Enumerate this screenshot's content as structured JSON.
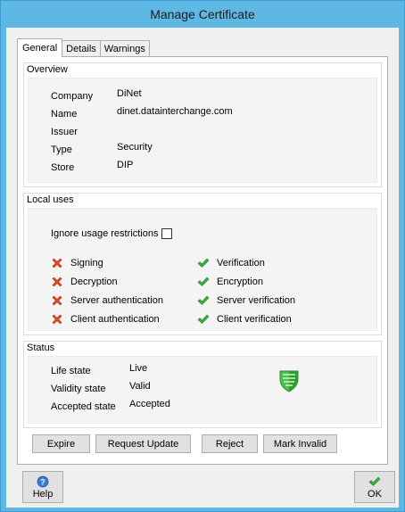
{
  "window": {
    "title": "Manage Certificate"
  },
  "tabs": [
    "General",
    "Details",
    "Warnings"
  ],
  "overview": {
    "title": "Overview",
    "fields": [
      {
        "label": "Company",
        "value": "DiNet"
      },
      {
        "label": "Name",
        "value": "dinet.datainterchange.com"
      },
      {
        "label": "Issuer",
        "value": ""
      },
      {
        "label": "Type",
        "value": "Security"
      },
      {
        "label": "Store",
        "value": "DIP"
      }
    ]
  },
  "local_uses": {
    "title": "Local uses",
    "ignore_label": "Ignore usage restrictions",
    "ignore_checked": false,
    "denied": [
      "Signing",
      "Decryption",
      "Server authentication",
      "Client authentication"
    ],
    "allowed": [
      "Verification",
      "Encryption",
      "Server verification",
      "Client verification"
    ]
  },
  "status": {
    "title": "Status",
    "fields": [
      {
        "label": "Life state",
        "value": "Live"
      },
      {
        "label": "Validity state",
        "value": "Valid"
      },
      {
        "label": "Accepted state",
        "value": "Accepted"
      }
    ],
    "icon": "green-shield-icon"
  },
  "actions": {
    "expire": "Expire",
    "request_update": "Request Update",
    "reject": "Reject",
    "mark_invalid": "Mark Invalid"
  },
  "footer": {
    "help": "Help",
    "ok": "OK"
  },
  "colors": {
    "titlebar": "#5fb8e4",
    "deny": "#e04a2a",
    "allow": "#3aae3a",
    "shield": "#4cc24c"
  }
}
